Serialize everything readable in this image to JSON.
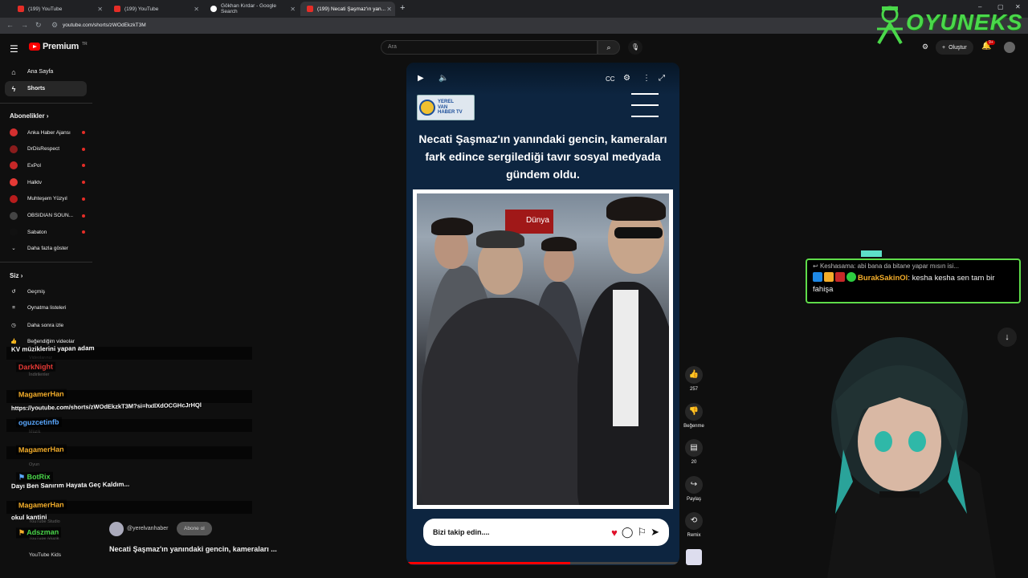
{
  "browser": {
    "tabs": [
      {
        "label": "(199) YouTube",
        "active": false
      },
      {
        "label": "(199) YouTube",
        "active": false
      },
      {
        "label": "Gökhan Kırdar - Google Search",
        "active": false
      },
      {
        "label": "(199) Necati Şaşmaz'ın yan...",
        "active": true
      }
    ],
    "url": "youtube.com/shorts/zWOdEkzkT3M"
  },
  "header": {
    "logo_text": "Premium",
    "logo_country": "TR",
    "search_placeholder": "Ara",
    "create_label": "Oluştur",
    "notif_count": "9+"
  },
  "sidebar": {
    "main": [
      {
        "label": "Ana Sayfa",
        "icon": "home-icon"
      },
      {
        "label": "Shorts",
        "icon": "shorts-icon",
        "selected": true
      }
    ],
    "subs_header": "Abonelikler",
    "subs": [
      {
        "label": "Anka Haber Ajansı",
        "color": "#d32f2f"
      },
      {
        "label": "DrDisRespect",
        "color": "#8a1c1c"
      },
      {
        "label": "ExPol",
        "color": "#c62828"
      },
      {
        "label": "Halktv",
        "color": "#e53935"
      },
      {
        "label": "Muhteşem Yüzyıl",
        "color": "#b71c1c"
      },
      {
        "label": "OBSIDIAN SOUN...",
        "color": "#444444"
      },
      {
        "label": "Sabaton",
        "color": "#111111"
      }
    ],
    "show_more": "Daha fazla göster",
    "you_header": "Siz",
    "you": [
      {
        "label": "Geçmiş",
        "icon": "history-icon"
      },
      {
        "label": "Oynatma listeleri",
        "icon": "playlist-icon"
      },
      {
        "label": "Daha sonra izle",
        "icon": "clock-icon"
      },
      {
        "label": "Beğendiğim videolar",
        "icon": "like-icon"
      }
    ],
    "faded": [
      "Videolarınız",
      "İndirilenler",
      "Müzik",
      "Oyun",
      "YouTube Studio",
      "YouTube Müzik",
      "YouTube Kids"
    ]
  },
  "chat_overlay": [
    {
      "type": "msg",
      "text": "KV müziklerini yapan adam"
    },
    {
      "type": "name",
      "text": "DarkNight",
      "color": "#e53935"
    },
    {
      "type": "name",
      "text": "MagamerHan",
      "color": "#f3ad2a"
    },
    {
      "type": "msg",
      "text": "https://youtube.com/shorts/zWOdEkzkT3M?si=hxIlXdOCGHcJrHQl"
    },
    {
      "type": "name",
      "text": "oguzcetinfb",
      "color": "#5aa8ff"
    },
    {
      "type": "name",
      "text": "MagamerHan",
      "color": "#f3ad2a"
    },
    {
      "type": "name",
      "text": "BotRix",
      "color": "#4ad84a"
    },
    {
      "type": "msg",
      "text": "Dayı Ben Sanırım Hayata Geç Kaldım..."
    },
    {
      "type": "name",
      "text": "MagamerHan",
      "color": "#f3ad2a"
    },
    {
      "type": "msg",
      "text": "okul kantini"
    },
    {
      "type": "name",
      "text": "Adszman",
      "color": "#4ad84a"
    }
  ],
  "short": {
    "logo_lines": [
      "YEREL",
      "VAN",
      "HABER TV"
    ],
    "headline": "Necati Şaşmaz'ın yanındaki gencin, kameraları fark edince sergilediği tavır sosyal medyada gündem oldu.",
    "photo_sign": "Dünya",
    "follow_text": "Bizi takip edin....",
    "progress": 0.6
  },
  "actions": {
    "likes": "257",
    "dislike_label": "Beğenme",
    "comments": "20",
    "share_label": "Paylaş",
    "remix_label": "Remix"
  },
  "channel": {
    "handle": "@yerelvanhaber",
    "subscribe_label": "Abone ol",
    "title": "Necati Şaşmaz'ın yanındaki gencin, kameraları ..."
  },
  "stream_chat": {
    "reply": "Keshasama: abi bana da bitane yapar mısın isi...",
    "user": "BurakSakinOl",
    "message": ": kesha kesha sen tam bir fahişa"
  },
  "brand": {
    "name": "OYUNEKS"
  }
}
